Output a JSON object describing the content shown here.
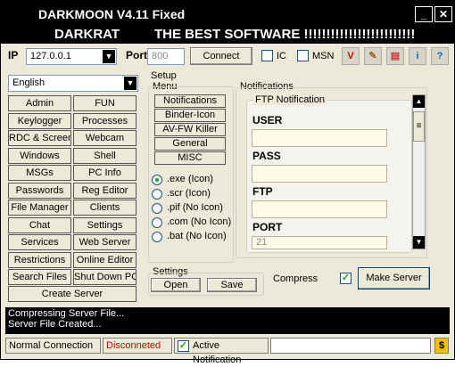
{
  "window": {
    "title": "DARKMOON V4.11 Fixed"
  },
  "banner": {
    "left": "DARKRAT",
    "right": "THE BEST SOFTWARE !!!!!!!!!!!!!!!!!!!!!!!!!"
  },
  "connection": {
    "ip_label": "IP",
    "ip_value": "127.0.0.1",
    "port_label": "Port",
    "port_value": "800",
    "connect_label": "Connect",
    "ic_label": "IC",
    "msn_label": "MSN"
  },
  "language": {
    "selected": "English"
  },
  "nav_buttons": [
    [
      "Admin",
      "FUN"
    ],
    [
      "Keylogger",
      "Processes"
    ],
    [
      "RDC & Screen",
      "Webcam"
    ],
    [
      "Windows",
      "Shell"
    ],
    [
      "MSGs",
      "PC Info"
    ],
    [
      "Passwords",
      "Reg Editor"
    ],
    [
      "File Manager",
      "Clients"
    ],
    [
      "Chat",
      "Settings"
    ],
    [
      "Services",
      "Web Server"
    ],
    [
      "Restrictions",
      "Online Editor"
    ],
    [
      "Search Files",
      "Shut Down PC"
    ]
  ],
  "create_server_label": "Create Server",
  "setup": {
    "title": "Setup",
    "menu_title": "Menu",
    "menu_items": [
      "Notifications",
      "Binder-Icon",
      "AV-FW Killer",
      "General",
      "MISC"
    ],
    "extensions": [
      {
        "label": ".exe (Icon)",
        "selected": true
      },
      {
        "label": ".scr (Icon)",
        "selected": false
      },
      {
        "label": ".pif (No Icon)",
        "selected": false
      },
      {
        "label": ".com (No Icon)",
        "selected": false
      },
      {
        "label": ".bat (No Icon)",
        "selected": false
      }
    ]
  },
  "notifications": {
    "title": "Notifications",
    "sub_title": "FTP Notification",
    "fields": [
      "USER",
      "PASS",
      "FTP",
      "PORT"
    ],
    "port_value": "21"
  },
  "settings": {
    "title": "Settings",
    "open_label": "Open",
    "save_label": "Save",
    "compress_label": "Compress",
    "compress_checked": "✓",
    "make_server_label": "Make Server"
  },
  "log": {
    "lines": [
      "Compressing Server File...",
      "Server File Created..."
    ]
  },
  "status": {
    "connection": "Normal Connection",
    "state": "Disconneted",
    "state_color": "#cc0000",
    "active_notification": "Active Notification",
    "active_checked": "✓",
    "money_icon": "$"
  },
  "icons": [
    "antivirus-icon",
    "brush-icon",
    "book-icon",
    "info-icon",
    "help-icon"
  ]
}
